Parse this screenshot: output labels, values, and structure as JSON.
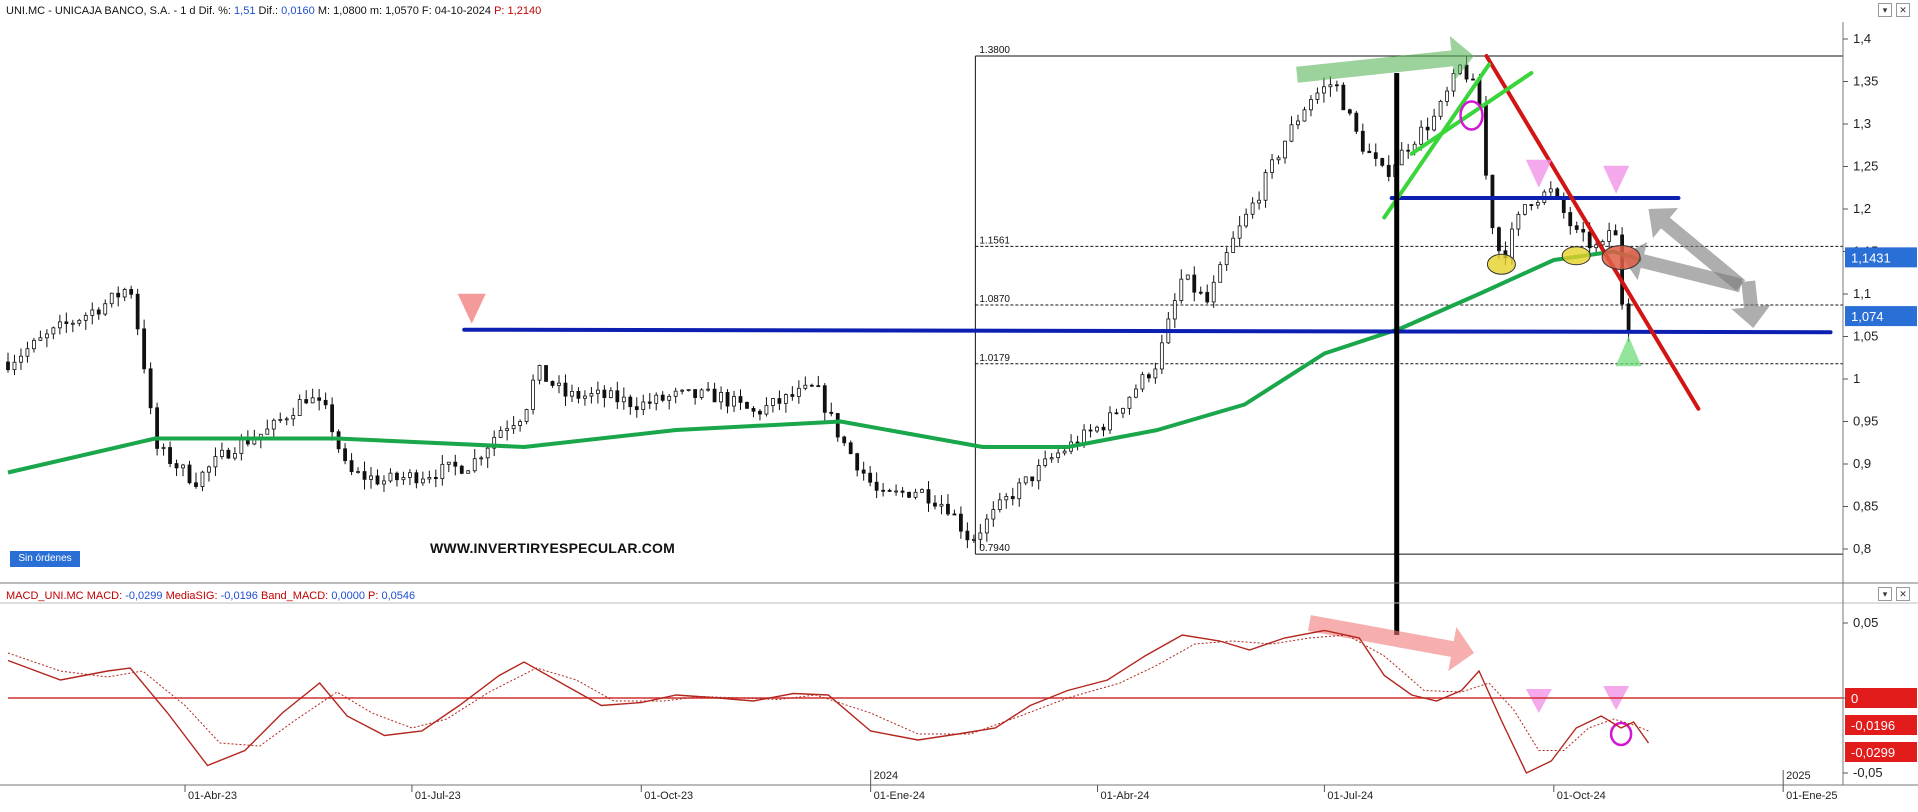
{
  "header": {
    "symbol": "UNI.MC - UNICAJA BANCO, S.A. -",
    "period": "1 d",
    "dif_pct_label": "Dif. %:",
    "dif_pct_value": "1,51",
    "dif_label": "Dif.:",
    "dif_value": "0,0160",
    "max_label": "M:",
    "max_value": "1,0800",
    "min_label": "m:",
    "min_value": "1,0570",
    "date_label": "F:",
    "date_value": "04-10-2024",
    "price_label": "P:",
    "price_value": "1,2140"
  },
  "macd_header": {
    "name": "MACD_UNI.MC",
    "macd_label": "MACD:",
    "macd_value": "-0,0299",
    "sig_label": "MediaSIG:",
    "sig_value": "-0,0196",
    "band_label": "Band_MACD:",
    "band_value": "0,0000",
    "p_label": "P:",
    "p_value": "0,0546"
  },
  "badges": {
    "orders": "Sin órdenes",
    "watermark": "WWW.INVERTIRYESPECULAR.COM",
    "price_last": "1,1431",
    "price_close": "1,074",
    "macd_zero": "0",
    "macd_sig": "-0,0196",
    "macd_val": "-0,0299"
  },
  "colors": {
    "candles": "#111111",
    "ma": "#1aa64a",
    "support": "#0d1fb0",
    "trend": "#d21414",
    "channel": "#3ad53a",
    "macd": "#b3261e",
    "signal": "#b3261e",
    "zero_line": "#d23030",
    "badge_blue": "#2a6fd6",
    "badge_red": "#e21b1b"
  },
  "chart_data": {
    "type": "candlestick",
    "instrument": "UNI.MC - UNICAJA BANCO, S.A.",
    "x_range": [
      "2023-01-20",
      "2025-01-25"
    ],
    "x_tick_labels": [
      {
        "date": "2023-04-01",
        "label": "01-Abr-23"
      },
      {
        "date": "2023-07-01",
        "label": "01-Jul-23"
      },
      {
        "date": "2023-10-01",
        "label": "01-Oct-23"
      },
      {
        "date": "2024-01-01",
        "label": "01-Ene-24"
      },
      {
        "date": "2024-04-01",
        "label": "01-Abr-24"
      },
      {
        "date": "2024-07-01",
        "label": "01-Jul-24"
      },
      {
        "date": "2024-10-01",
        "label": "01-Oct-24"
      },
      {
        "date": "2025-01-01",
        "label": "01-Ene-25"
      }
    ],
    "year_markers": [
      {
        "date": "2024-01-01",
        "label": "2024"
      },
      {
        "date": "2025-01-01",
        "label": "2025"
      }
    ],
    "price_axis": {
      "ylim": [
        0.76,
        1.42
      ],
      "ticks": [
        {
          "value": 1.4,
          "label": "1,4"
        },
        {
          "value": 1.35,
          "label": "1,35"
        },
        {
          "value": 1.3,
          "label": "1,3"
        },
        {
          "value": 1.25,
          "label": "1,25"
        },
        {
          "value": 1.2,
          "label": "1,2"
        },
        {
          "value": 1.15,
          "label": "1,15"
        },
        {
          "value": 1.1,
          "label": "1,1"
        },
        {
          "value": 1.05,
          "label": "1,05"
        },
        {
          "value": 1.0,
          "label": "1"
        },
        {
          "value": 0.95,
          "label": "0,95"
        },
        {
          "value": 0.9,
          "label": "0,9"
        },
        {
          "value": 0.85,
          "label": "0,85"
        },
        {
          "value": 0.8,
          "label": "0,8"
        }
      ]
    },
    "macd_axis": {
      "ylim": [
        -0.058,
        0.062
      ],
      "ticks": [
        {
          "value": 0.05,
          "label": "0,05"
        },
        {
          "value": 0,
          "label": "0"
        },
        {
          "value": -0.05,
          "label": "-0,05"
        }
      ]
    },
    "price_series": [
      [
        "2023-01-20",
        1.02
      ],
      [
        "2023-02-10",
        1.06
      ],
      [
        "2023-03-01",
        1.09
      ],
      [
        "2023-03-10",
        1.11
      ],
      [
        "2023-03-15",
        1.03
      ],
      [
        "2023-03-20",
        0.92
      ],
      [
        "2023-04-05",
        0.88
      ],
      [
        "2023-04-20",
        0.92
      ],
      [
        "2023-05-05",
        0.94
      ],
      [
        "2023-05-20",
        0.98
      ],
      [
        "2023-05-28",
        0.96
      ],
      [
        "2023-06-05",
        0.89
      ],
      [
        "2023-06-20",
        0.88
      ],
      [
        "2023-07-10",
        0.89
      ],
      [
        "2023-07-25",
        0.9
      ],
      [
        "2023-08-05",
        0.94
      ],
      [
        "2023-08-15",
        0.96
      ],
      [
        "2023-08-20",
        1.01
      ],
      [
        "2023-09-01",
        0.98
      ],
      [
        "2023-09-15",
        0.98
      ],
      [
        "2023-10-01",
        0.97
      ],
      [
        "2023-10-15",
        0.98
      ],
      [
        "2023-11-01",
        0.98
      ],
      [
        "2023-11-15",
        0.96
      ],
      [
        "2023-12-01",
        0.98
      ],
      [
        "2023-12-10",
        0.99
      ],
      [
        "2023-12-20",
        0.93
      ],
      [
        "2024-01-05",
        0.86
      ],
      [
        "2024-01-20",
        0.87
      ],
      [
        "2024-02-01",
        0.85
      ],
      [
        "2024-02-10",
        0.81
      ],
      [
        "2024-02-25",
        0.86
      ],
      [
        "2024-03-15",
        0.91
      ],
      [
        "2024-04-05",
        0.95
      ],
      [
        "2024-04-25",
        1.02
      ],
      [
        "2024-05-05",
        1.12
      ],
      [
        "2024-05-15",
        1.09
      ],
      [
        "2024-05-25",
        1.16
      ],
      [
        "2024-06-05",
        1.22
      ],
      [
        "2024-06-15",
        1.28
      ],
      [
        "2024-06-25",
        1.33
      ],
      [
        "2024-07-05",
        1.35
      ],
      [
        "2024-07-15",
        1.28
      ],
      [
        "2024-07-25",
        1.24
      ],
      [
        "2024-08-05",
        1.28
      ],
      [
        "2024-08-15",
        1.31
      ],
      [
        "2024-08-25",
        1.37
      ],
      [
        "2024-09-01",
        1.33
      ],
      [
        "2024-09-05",
        1.2
      ],
      [
        "2024-09-10",
        1.14
      ],
      [
        "2024-09-20",
        1.21
      ],
      [
        "2024-09-30",
        1.22
      ],
      [
        "2024-10-10",
        1.17
      ],
      [
        "2024-10-20",
        1.15
      ],
      [
        "2024-10-25",
        1.19
      ],
      [
        "2024-10-28",
        1.1
      ],
      [
        "2024-10-30",
        1.06
      ],
      [
        "2024-11-02",
        1.07
      ]
    ],
    "moving_average": [
      [
        "2023-01-20",
        0.89
      ],
      [
        "2023-03-20",
        0.93
      ],
      [
        "2023-06-01",
        0.93
      ],
      [
        "2023-08-15",
        0.92
      ],
      [
        "2023-10-15",
        0.94
      ],
      [
        "2023-12-20",
        0.95
      ],
      [
        "2024-02-15",
        0.92
      ],
      [
        "2024-03-20",
        0.92
      ],
      [
        "2024-04-25",
        0.94
      ],
      [
        "2024-05-30",
        0.97
      ],
      [
        "2024-07-01",
        1.03
      ],
      [
        "2024-08-01",
        1.06
      ],
      [
        "2024-09-01",
        1.1
      ],
      [
        "2024-10-01",
        1.14
      ],
      [
        "2024-10-25",
        1.15
      ],
      [
        "2024-11-05",
        1.14
      ]
    ],
    "fibonacci": {
      "start": "2024-02-12",
      "end": "2025-01-25",
      "levels": [
        {
          "value": 1.38,
          "label": "1.3800"
        },
        {
          "value": 1.1561,
          "label": "1.1561"
        },
        {
          "value": 1.087,
          "label": "1.0870"
        },
        {
          "value": 1.0179,
          "label": "1.0179"
        },
        {
          "value": 0.794,
          "label": "0.7940"
        }
      ]
    },
    "annotations": {
      "support_line": {
        "start": [
          "2023-07-22",
          1.058
        ],
        "end": [
          "2025-01-20",
          1.055
        ]
      },
      "resistance_line": {
        "start": [
          "2024-07-28",
          1.213
        ],
        "end": [
          "2024-11-20",
          1.213
        ]
      },
      "trend_line": {
        "start": [
          "2024-09-04",
          1.38
        ],
        "end": [
          "2024-11-28",
          0.965
        ]
      },
      "channel_lower": {
        "start": [
          "2024-07-25",
          1.19
        ],
        "end": [
          "2024-09-05",
          1.37
        ]
      },
      "channel_upper": {
        "start": [
          "2024-08-05",
          1.265
        ],
        "end": [
          "2024-09-22",
          1.36
        ]
      },
      "vertical_marker": "2024-07-30",
      "macd_vertical_bottom": 0.042
    },
    "macd_series": [
      [
        "2023-01-20",
        0.025
      ],
      [
        "2023-02-10",
        0.012
      ],
      [
        "2023-03-01",
        0.018
      ],
      [
        "2023-03-10",
        0.02
      ],
      [
        "2023-03-25",
        -0.01
      ],
      [
        "2023-04-10",
        -0.045
      ],
      [
        "2023-04-25",
        -0.035
      ],
      [
        "2023-05-10",
        -0.01
      ],
      [
        "2023-05-25",
        0.01
      ],
      [
        "2023-06-05",
        -0.012
      ],
      [
        "2023-06-20",
        -0.025
      ],
      [
        "2023-07-05",
        -0.022
      ],
      [
        "2023-07-20",
        -0.005
      ],
      [
        "2023-08-05",
        0.015
      ],
      [
        "2023-08-15",
        0.024
      ],
      [
        "2023-09-01",
        0.008
      ],
      [
        "2023-09-15",
        -0.005
      ],
      [
        "2023-10-01",
        -0.003
      ],
      [
        "2023-10-15",
        0.002
      ],
      [
        "2023-11-01",
        0.0
      ],
      [
        "2023-11-15",
        -0.002
      ],
      [
        "2023-12-01",
        0.003
      ],
      [
        "2023-12-15",
        0.002
      ],
      [
        "2024-01-01",
        -0.022
      ],
      [
        "2024-01-20",
        -0.028
      ],
      [
        "2024-02-05",
        -0.024
      ],
      [
        "2024-02-20",
        -0.02
      ],
      [
        "2024-03-05",
        -0.005
      ],
      [
        "2024-03-20",
        0.005
      ],
      [
        "2024-04-05",
        0.012
      ],
      [
        "2024-04-20",
        0.028
      ],
      [
        "2024-05-05",
        0.042
      ],
      [
        "2024-05-20",
        0.038
      ],
      [
        "2024-06-01",
        0.032
      ],
      [
        "2024-06-15",
        0.04
      ],
      [
        "2024-07-01",
        0.045
      ],
      [
        "2024-07-15",
        0.04
      ],
      [
        "2024-07-25",
        0.015
      ],
      [
        "2024-08-05",
        0.002
      ],
      [
        "2024-08-15",
        -0.002
      ],
      [
        "2024-08-25",
        0.005
      ],
      [
        "2024-09-01",
        0.018
      ],
      [
        "2024-09-10",
        -0.015
      ],
      [
        "2024-09-20",
        -0.05
      ],
      [
        "2024-09-30",
        -0.042
      ],
      [
        "2024-10-10",
        -0.02
      ],
      [
        "2024-10-20",
        -0.012
      ],
      [
        "2024-10-28",
        -0.02
      ],
      [
        "2024-11-02",
        -0.016
      ],
      [
        "2024-11-08",
        -0.03
      ]
    ],
    "signal_series": [
      [
        "2023-01-20",
        0.03
      ],
      [
        "2023-02-10",
        0.018
      ],
      [
        "2023-03-01",
        0.014
      ],
      [
        "2023-03-15",
        0.018
      ],
      [
        "2023-04-01",
        -0.005
      ],
      [
        "2023-04-15",
        -0.03
      ],
      [
        "2023-05-01",
        -0.032
      ],
      [
        "2023-05-15",
        -0.015
      ],
      [
        "2023-06-01",
        0.004
      ],
      [
        "2023-06-15",
        -0.01
      ],
      [
        "2023-07-01",
        -0.02
      ],
      [
        "2023-07-15",
        -0.014
      ],
      [
        "2023-08-01",
        0.004
      ],
      [
        "2023-08-20",
        0.02
      ],
      [
        "2023-09-05",
        0.012
      ],
      [
        "2023-09-20",
        -0.002
      ],
      [
        "2023-10-10",
        -0.002
      ],
      [
        "2023-10-25",
        0.001
      ],
      [
        "2023-11-10",
        0.0
      ],
      [
        "2023-11-25",
        -0.001
      ],
      [
        "2023-12-10",
        0.002
      ],
      [
        "2024-01-01",
        -0.01
      ],
      [
        "2024-01-20",
        -0.024
      ],
      [
        "2024-02-10",
        -0.024
      ],
      [
        "2024-03-01",
        -0.012
      ],
      [
        "2024-03-20",
        0.0
      ],
      [
        "2024-04-10",
        0.01
      ],
      [
        "2024-04-25",
        0.022
      ],
      [
        "2024-05-10",
        0.036
      ],
      [
        "2024-05-25",
        0.038
      ],
      [
        "2024-06-10",
        0.036
      ],
      [
        "2024-06-25",
        0.04
      ],
      [
        "2024-07-10",
        0.042
      ],
      [
        "2024-07-25",
        0.028
      ],
      [
        "2024-08-10",
        0.005
      ],
      [
        "2024-08-25",
        0.004
      ],
      [
        "2024-09-05",
        0.01
      ],
      [
        "2024-09-15",
        -0.008
      ],
      [
        "2024-09-25",
        -0.035
      ],
      [
        "2024-10-05",
        -0.035
      ],
      [
        "2024-10-15",
        -0.02
      ],
      [
        "2024-10-25",
        -0.014
      ],
      [
        "2024-11-02",
        -0.018
      ],
      [
        "2024-11-08",
        -0.022
      ]
    ]
  }
}
